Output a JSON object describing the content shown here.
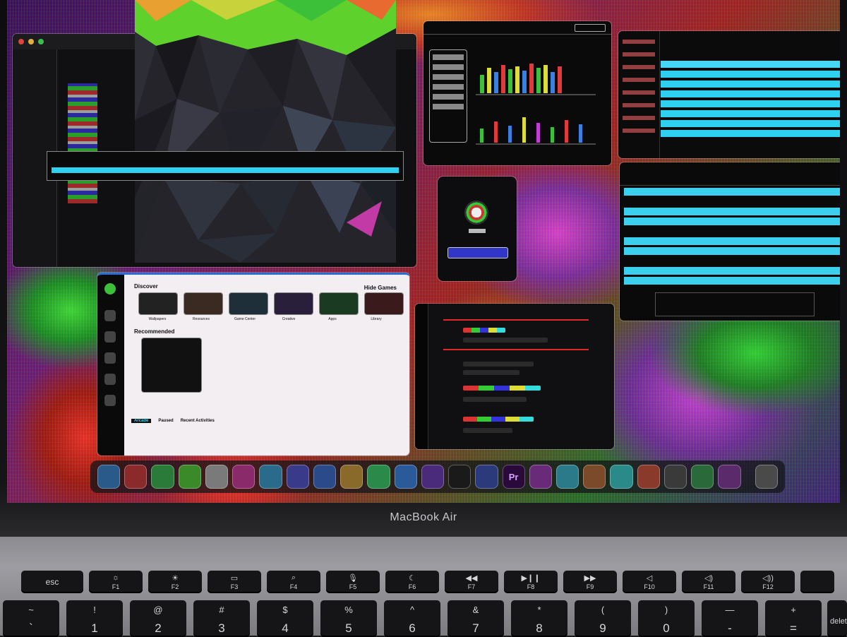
{
  "device": {
    "brand_label": "MacBook Air"
  },
  "screen": {
    "app_store": {
      "section_title": "Discover",
      "section_right_link": "Hide Games",
      "recommended_title": "Recommended",
      "tabs": [
        "Arcade",
        "Paused",
        "Recent Activities"
      ],
      "tile_captions": [
        "Wallpapers",
        "Resources",
        "Game Center",
        "Creative",
        "Apps",
        "Library"
      ]
    },
    "dock": {
      "premiere_label": "Pr"
    }
  },
  "keyboard": {
    "function_row": [
      {
        "label": "esc",
        "icon": ""
      },
      {
        "label": "F1",
        "icon": "☼"
      },
      {
        "label": "F2",
        "icon": "☀"
      },
      {
        "label": "F3",
        "icon": "▭"
      },
      {
        "label": "F4",
        "icon": "⌕"
      },
      {
        "label": "F5",
        "icon": "🎙"
      },
      {
        "label": "F6",
        "icon": "☾"
      },
      {
        "label": "F7",
        "icon": "◀◀"
      },
      {
        "label": "F8",
        "icon": "▶❙❙"
      },
      {
        "label": "F9",
        "icon": "▶▶"
      },
      {
        "label": "F10",
        "icon": "◁"
      },
      {
        "label": "F11",
        "icon": "◁)"
      },
      {
        "label": "F12",
        "icon": "◁))"
      }
    ],
    "number_row": [
      {
        "upper": "~",
        "lower": "`"
      },
      {
        "upper": "!",
        "lower": "1"
      },
      {
        "upper": "@",
        "lower": "2"
      },
      {
        "upper": "#",
        "lower": "3"
      },
      {
        "upper": "$",
        "lower": "4"
      },
      {
        "upper": "%",
        "lower": "5"
      },
      {
        "upper": "^",
        "lower": "6"
      },
      {
        "upper": "&",
        "lower": "7"
      },
      {
        "upper": "*",
        "lower": "8"
      },
      {
        "upper": "(",
        "lower": "9"
      },
      {
        "upper": ")",
        "lower": "0"
      },
      {
        "upper": "—",
        "lower": "-"
      },
      {
        "upper": "+",
        "lower": "="
      },
      {
        "upper": "",
        "lower": "delete"
      }
    ]
  },
  "colors": {
    "selection_cyan": "#2ed1f0",
    "accent_red": "#e02a2a",
    "accent_blue": "#2a6bd8"
  }
}
